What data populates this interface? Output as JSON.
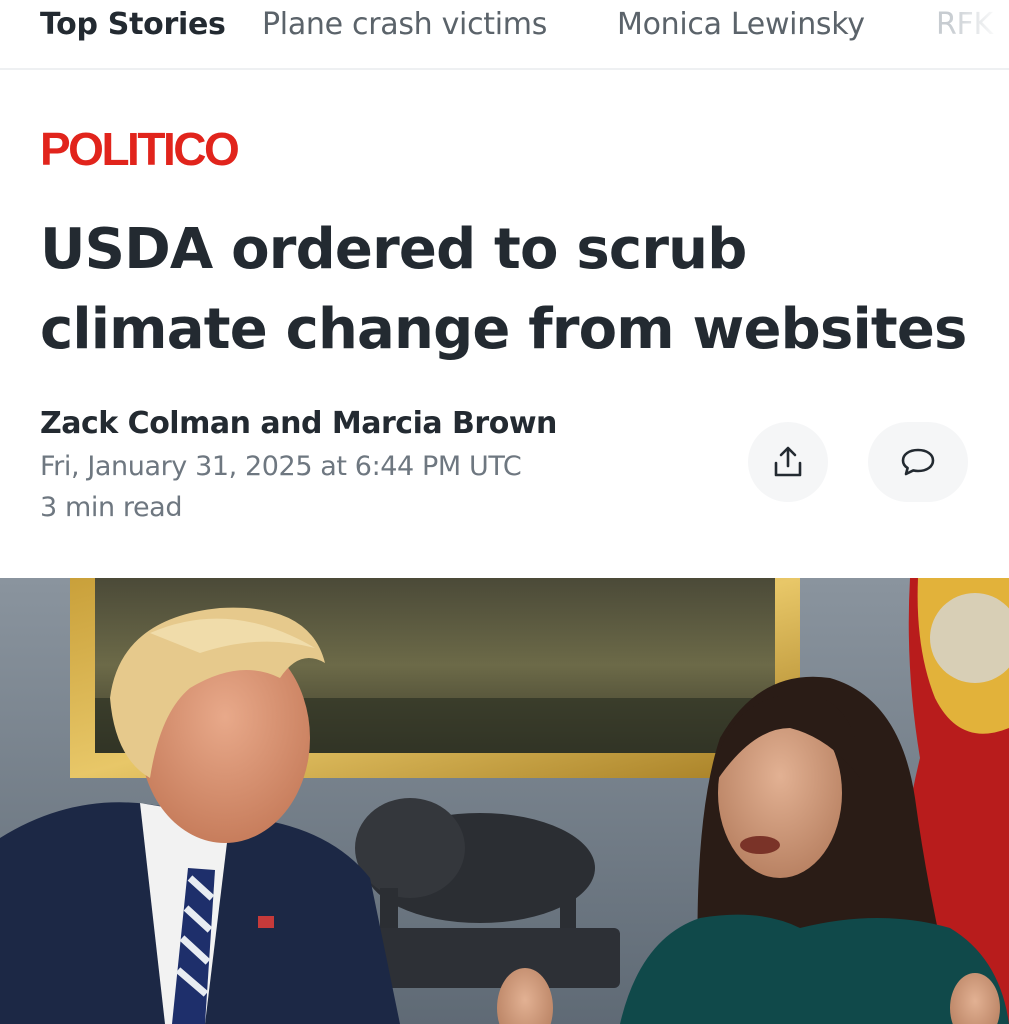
{
  "tabs": [
    {
      "label": "Top Stories",
      "active": true
    },
    {
      "label": "Plane crash victims",
      "active": false
    },
    {
      "label": "Monica Lewinsky",
      "active": false
    },
    {
      "label": "RFK Jr.",
      "active": false
    }
  ],
  "article": {
    "publisher": "POLITICO",
    "headline": "USDA ordered to scrub climate change from websites",
    "authors": "Zack Colman and Marcia Brown",
    "date": "Fri, January 31, 2025 at 6:44 PM UTC",
    "read_time": "3 min read"
  },
  "actions": {
    "share_icon": "share-icon",
    "comment_icon": "comment-icon"
  },
  "hero_image": {
    "icon": "photo",
    "subject": "article-hero-photo"
  },
  "colors": {
    "publisher_red": "#e1241c",
    "text_primary": "#232a31",
    "text_secondary": "#6e7780",
    "button_bg": "#f5f6f7"
  }
}
